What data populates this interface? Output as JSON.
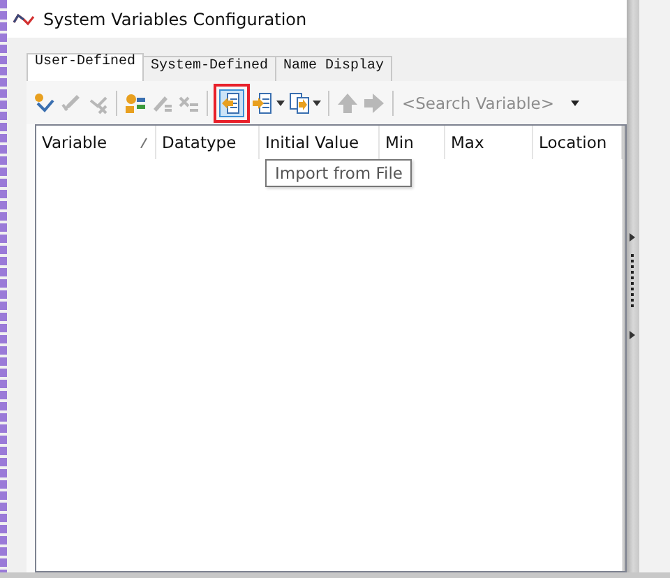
{
  "window": {
    "title": "System Variables Configuration"
  },
  "tabs": [
    {
      "label": "User-Defined",
      "selected": true
    },
    {
      "label": "System-Defined",
      "selected": false
    },
    {
      "label": "Name Display",
      "selected": false
    }
  ],
  "toolbar": [
    {
      "kind": "button",
      "enabled": true,
      "selected": false
    },
    {
      "kind": "button",
      "enabled": false,
      "selected": false
    },
    {
      "kind": "button",
      "enabled": false,
      "selected": false
    },
    {
      "kind": "separator"
    },
    {
      "kind": "button",
      "enabled": true,
      "selected": false
    },
    {
      "kind": "button",
      "enabled": false,
      "selected": false
    },
    {
      "kind": "button",
      "enabled": false,
      "selected": false
    },
    {
      "kind": "separator"
    },
    {
      "kind": "button",
      "enabled": true,
      "selected": true
    },
    {
      "kind": "dropdown",
      "enabled": true,
      "selected": false
    },
    {
      "kind": "dropdown",
      "enabled": true,
      "selected": false
    },
    {
      "kind": "separator"
    },
    {
      "kind": "button",
      "enabled": false,
      "selected": false
    },
    {
      "kind": "button",
      "enabled": false,
      "selected": false
    },
    {
      "kind": "separator"
    }
  ],
  "search": {
    "placeholder": "<Search Variable>"
  },
  "table": {
    "columns": [
      {
        "label": "Variable",
        "sorted": true
      },
      {
        "label": "Datatype",
        "sorted": false
      },
      {
        "label": "Initial Value",
        "sorted": false
      },
      {
        "label": "Min",
        "sorted": false
      },
      {
        "label": "Max",
        "sorted": false
      },
      {
        "label": "Location",
        "sorted": false
      }
    ]
  },
  "tooltip": {
    "text": "Import from File"
  }
}
